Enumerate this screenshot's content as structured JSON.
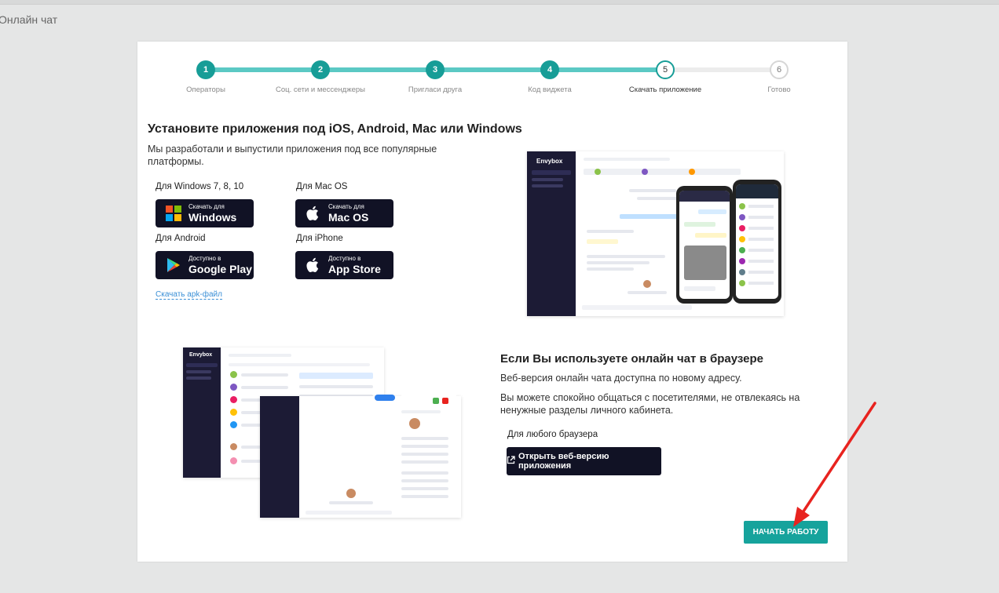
{
  "page": {
    "title": "Онлайн чат"
  },
  "stepper": {
    "steps": [
      {
        "number": "1",
        "label": "Операторы",
        "state": "done"
      },
      {
        "number": "2",
        "label": "Соц. сети и мессенджеры",
        "state": "done"
      },
      {
        "number": "3",
        "label": "Пригласи друга",
        "state": "done"
      },
      {
        "number": "4",
        "label": "Код виджета",
        "state": "done"
      },
      {
        "number": "5",
        "label": "Скачать приложение",
        "state": "active"
      },
      {
        "number": "6",
        "label": "Готово",
        "state": "todo"
      }
    ]
  },
  "apps": {
    "heading": "Установите приложения под iOS, Android, Mac или Windows",
    "description": "Мы разработали и выпустили приложения под все популярные платформы.",
    "windows": {
      "label": "Для Windows 7, 8, 10",
      "small": "Скачать для",
      "big": "Windows"
    },
    "mac": {
      "label": "Для Mac OS",
      "small": "Скачать для",
      "big": "Mac OS"
    },
    "android": {
      "label": "Для Android",
      "small": "Доступно в",
      "big": "Google Play"
    },
    "iphone": {
      "label": "Для iPhone",
      "small": "Доступно в",
      "big": "App Store"
    },
    "apk_link": "Скачать apk-файл"
  },
  "web": {
    "heading": "Если Вы используете онлайн чат в браузере",
    "line1": "Веб-версия онлайн чата доступна по новому адресу.",
    "line2": "Вы можете спокойно общаться с посетителями, не отвлекаясь на ненужные разделы личного кабинета.",
    "label": "Для любого браузера",
    "button": "Открыть веб-версию приложения"
  },
  "start_button": "НАЧАТЬ РАБОТУ",
  "mockup": {
    "brand": "Envybox"
  },
  "colors": {
    "accent": "#179d97",
    "dark": "#111225",
    "link": "#3a8fd6",
    "arrow": "#e8231f"
  }
}
